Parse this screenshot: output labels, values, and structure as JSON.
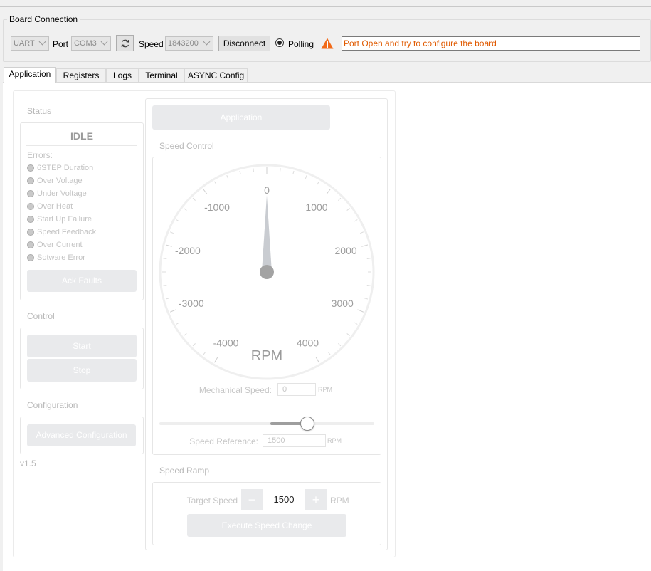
{
  "board_connection": {
    "title": "Board Connection",
    "interface_value": "UART",
    "port_label": "Port",
    "port_value": "COM3",
    "speed_label": "Speed",
    "speed_value": "1843200",
    "disconnect_label": "Disconnect",
    "polling_label": "Polling",
    "status_message": "Port Open and try to configure the board",
    "status_color": "#e05a00",
    "warning_color": "#f26a18"
  },
  "tabs": [
    {
      "label": "Application",
      "active": true
    },
    {
      "label": "Registers"
    },
    {
      "label": "Logs"
    },
    {
      "label": "Terminal"
    },
    {
      "label": "ASYNC Config"
    }
  ],
  "status": {
    "section_title": "Status",
    "state": "IDLE",
    "errors_label": "Errors:",
    "errors": [
      "6STEP Duration",
      "Over Voltage",
      "Under Voltage",
      "Over Heat",
      "Start Up Failure",
      "Speed Feedback",
      "Over Current",
      "Sotware Error"
    ],
    "ack_button": "Ack Faults"
  },
  "control": {
    "section_title": "Control",
    "start_button": "Start",
    "stop_button": "Stop"
  },
  "configuration": {
    "section_title": "Configuration",
    "advanced_button": "Advanced Configuration"
  },
  "version": "v1.5",
  "application": {
    "header_button": "Application",
    "speed_control_title": "Speed Control",
    "gauge": {
      "unit": "RPM",
      "min": -4000,
      "max": 4000,
      "value": 0,
      "tick_labels": [
        "-4000",
        "-3000",
        "-2000",
        "-1000",
        "0",
        "1000",
        "2000",
        "3000",
        "4000"
      ]
    },
    "mechanical_speed_label": "Mechanical Speed:",
    "mechanical_speed_value": "0",
    "mechanical_speed_unit": "RPM",
    "slider_value_fraction": 0.69,
    "speed_reference_label": "Speed Reference:",
    "speed_reference_value": "1500",
    "speed_reference_unit": "RPM",
    "speed_ramp_title": "Speed Ramp",
    "target_speed_label": "Target Speed",
    "target_speed_value": "1500",
    "target_speed_unit": "RPM",
    "minus_symbol": "−",
    "plus_symbol": "+",
    "execute_button": "Execute Speed Change"
  }
}
